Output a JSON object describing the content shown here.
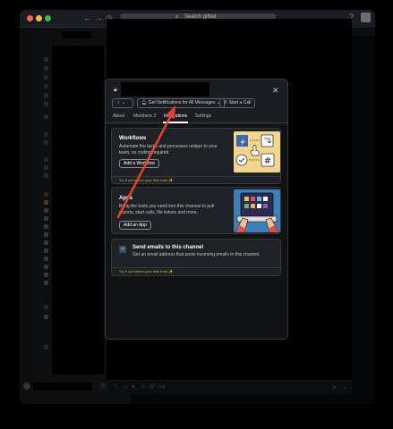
{
  "window": {
    "traffic_lights": [
      "#fe5f57",
      "#febc2e",
      "#28c840"
    ],
    "search_placeholder": "Search gifted"
  },
  "modal": {
    "notifications_button": "Get Notifications for All Messages",
    "call_button": "Start a Call",
    "tabs": [
      {
        "label": "About",
        "active": false
      },
      {
        "label": "Members 3",
        "active": false
      },
      {
        "label": "Integrations",
        "active": true
      },
      {
        "label": "Settings",
        "active": false
      }
    ],
    "workflows": {
      "title": "Workflows",
      "description": "Automate the tasks and processes unique to your team, no coding required.",
      "button": "Add a Workflow",
      "trial": "Try it out before your trial ends ✨"
    },
    "apps": {
      "title": "Apps",
      "description": "Bring the tools you need into this channel to pull reports, start calls, file tickets and more.",
      "button": "Add an App"
    },
    "email": {
      "title": "Send emails to this channel",
      "description": "Get an email address that posts incoming emails in this channel.",
      "trial": "Try it out before your trial ends ✨"
    }
  },
  "colors": {
    "annotation_arrow": "#e8402a",
    "accent": "#1164a3",
    "trial_text": "#d6b656"
  }
}
